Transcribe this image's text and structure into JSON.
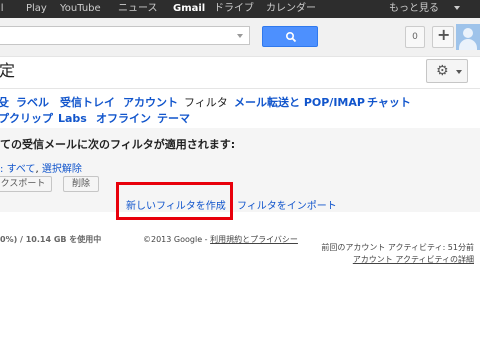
{
  "topbar": {
    "links": [
      "ll",
      "Play",
      "YouTube",
      "ニュース",
      "Gmail",
      "ドライブ",
      "カレンダー",
      "もっと見る"
    ]
  },
  "header": {
    "notification_count": "0",
    "share_label": "+"
  },
  "settings": {
    "title": "定",
    "tabs_row1": [
      "殳",
      "ラベル",
      "受信トレイ",
      "アカウント",
      "フィルタ",
      "メール転送と POP/IMAP",
      "チャット"
    ],
    "tabs_row2": [
      "プクリップ",
      "Labs",
      "オフライン",
      "テーマ"
    ],
    "active_tab": "フィルタ"
  },
  "filters": {
    "heading": "ての受信メールに次のフィルタが適用されます:",
    "select_prefix": ":",
    "select_all": "すべて",
    "select_none": "選択解除",
    "export_label": "クスポート",
    "delete_label": "削除",
    "new_filter_label": "新しいフィルタを作成",
    "import_filter_label": "フィルタをインポート"
  },
  "footer": {
    "storage": "0%) / 10.14 GB を使用中",
    "copyright": "©2013 Google - ",
    "terms_link": "利用規約とプライバシー",
    "last_activity": "前回のアカウント アクティビティ: 51分前",
    "activity_details": "アカウント アクティビティの詳細"
  },
  "colors": {
    "topbar": "#2d2d2d",
    "search_button": "#4d90fe",
    "link": "#1155cc",
    "highlight": "#e8000b"
  }
}
